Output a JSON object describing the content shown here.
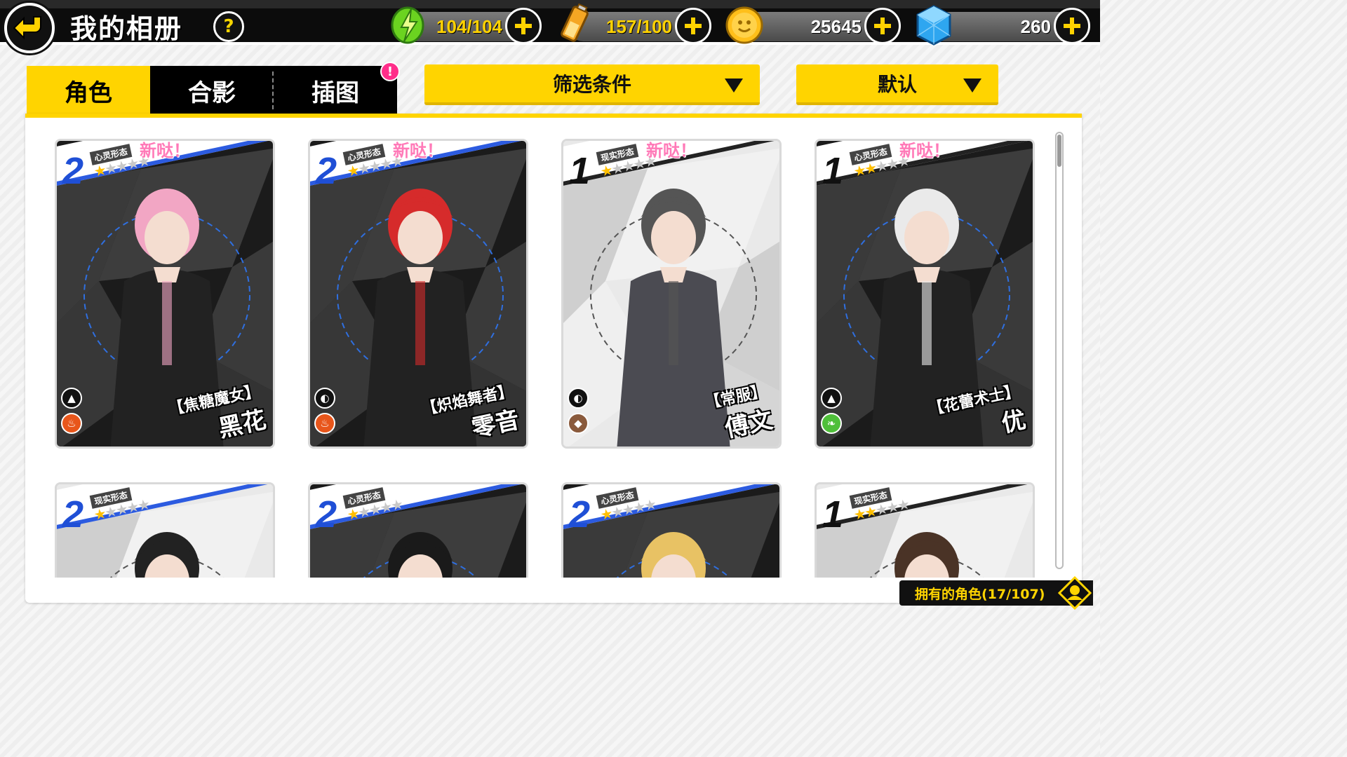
{
  "header": {
    "title": "我的相册",
    "help_label": "?",
    "resources": [
      {
        "name": "stamina",
        "icon": "green-lightning-icon",
        "value": "104/104",
        "color": "#ffd200"
      },
      {
        "name": "battery",
        "icon": "battery-icon",
        "value": "157/100",
        "color": "#ffd200"
      },
      {
        "name": "gold",
        "icon": "gold-coin-icon",
        "value": "25645",
        "color": "#ffffff"
      },
      {
        "name": "crystal",
        "icon": "blue-crystal-icon",
        "value": "260",
        "color": "#ffffff"
      }
    ]
  },
  "tabs": [
    {
      "label": "角色",
      "active": true
    },
    {
      "label": "合影",
      "active": false
    },
    {
      "label": "插图",
      "active": false
    }
  ],
  "notify_badge": "!",
  "filters": {
    "filter_label": "筛选条件",
    "sort_label": "默认"
  },
  "cards": [
    {
      "rank": "2",
      "rank_color": "#1f4fd6",
      "form": "心灵形态",
      "stars_on": 1,
      "stars_total": 5,
      "new_label": "新哒！",
      "title": "【焦糖魔女】",
      "name": "黑花",
      "palette": "dark",
      "accent": "#f2a6c4",
      "element_icon": "fire-icon",
      "element_color": "#e8561b",
      "type_icon": "triangle-icon"
    },
    {
      "rank": "2",
      "rank_color": "#1f4fd6",
      "form": "心灵形态",
      "stars_on": 1,
      "stars_total": 5,
      "new_label": "新哒！",
      "title": "【炽焰舞者】",
      "name": "零音",
      "palette": "dark",
      "accent": "#d62b2b",
      "element_icon": "fire-icon",
      "element_color": "#e8561b",
      "type_icon": "shield-icon"
    },
    {
      "rank": "1",
      "rank_color": "#111111",
      "form": "现实形态",
      "stars_on": 1,
      "stars_total": 5,
      "new_label": "新哒！",
      "title": "【常服】",
      "name": "傅文",
      "palette": "light",
      "accent": "#555555",
      "element_icon": "earth-icon",
      "element_color": "#8a5a3c",
      "type_icon": "shield-icon"
    },
    {
      "rank": "1",
      "rank_color": "#111111",
      "form": "心灵形态",
      "stars_on": 2,
      "stars_total": 5,
      "new_label": "新哒！",
      "title": "【花蕾术士】",
      "name": "优",
      "palette": "dark",
      "accent": "#eaeaea",
      "element_icon": "leaf-icon",
      "element_color": "#4fbf3a",
      "type_icon": "triangle-icon"
    },
    {
      "rank": "2",
      "rank_color": "#1f4fd6",
      "form": "现实形态",
      "stars_on": 1,
      "stars_total": 5,
      "new_label": "",
      "title": "",
      "name": "",
      "palette": "light",
      "accent": "#222222",
      "element_icon": "",
      "element_color": "",
      "type_icon": ""
    },
    {
      "rank": "2",
      "rank_color": "#1f4fd6",
      "form": "心灵形态",
      "stars_on": 1,
      "stars_total": 5,
      "new_label": "",
      "title": "",
      "name": "",
      "palette": "dark",
      "accent": "#1a1a1a",
      "element_icon": "",
      "element_color": "",
      "type_icon": ""
    },
    {
      "rank": "2",
      "rank_color": "#1f4fd6",
      "form": "心灵形态",
      "stars_on": 1,
      "stars_total": 5,
      "new_label": "",
      "title": "",
      "name": "",
      "palette": "dark",
      "accent": "#e8c264",
      "element_icon": "",
      "element_color": "",
      "type_icon": ""
    },
    {
      "rank": "1",
      "rank_color": "#111111",
      "form": "现实形态",
      "stars_on": 2,
      "stars_total": 5,
      "new_label": "",
      "title": "",
      "name": "",
      "palette": "light",
      "accent": "#4a3326",
      "element_icon": "",
      "element_color": "",
      "type_icon": ""
    }
  ],
  "owned": {
    "label": "拥有的角色(17/107)"
  }
}
